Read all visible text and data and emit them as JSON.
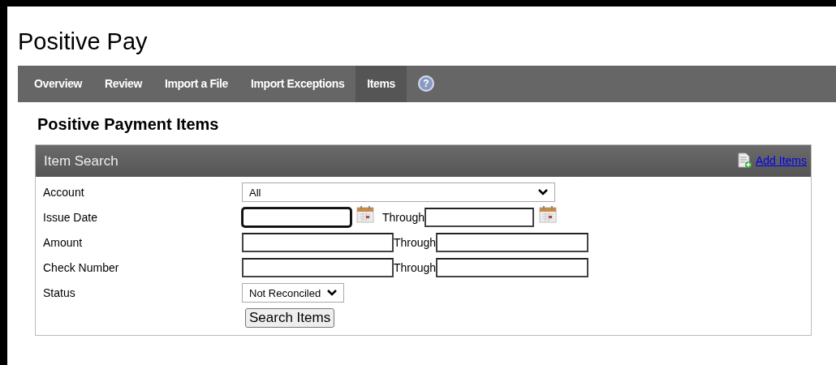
{
  "app_title": "Positive Pay",
  "nav": [
    {
      "label": "Overview",
      "selected": false
    },
    {
      "label": "Review",
      "selected": false
    },
    {
      "label": "Import a File",
      "selected": false
    },
    {
      "label": "Import Exceptions",
      "selected": false
    },
    {
      "label": "Items",
      "selected": true
    }
  ],
  "help_label": "?",
  "page_title": "Positive Payment Items",
  "panel": {
    "title": "Item Search",
    "action_link": "Add Items",
    "rows": [
      {
        "kind": "select",
        "label": "Account",
        "value": "All"
      },
      {
        "kind": "date_range",
        "label": "Issue Date",
        "through_label": "Through",
        "from_focused": true
      },
      {
        "kind": "range",
        "label": "Amount",
        "through_label": "Through"
      },
      {
        "kind": "range",
        "label": "Check Number",
        "through_label": "Through"
      },
      {
        "kind": "select_small",
        "label": "Status",
        "value": "Not Reconciled"
      }
    ],
    "search_button": "Search Items"
  }
}
